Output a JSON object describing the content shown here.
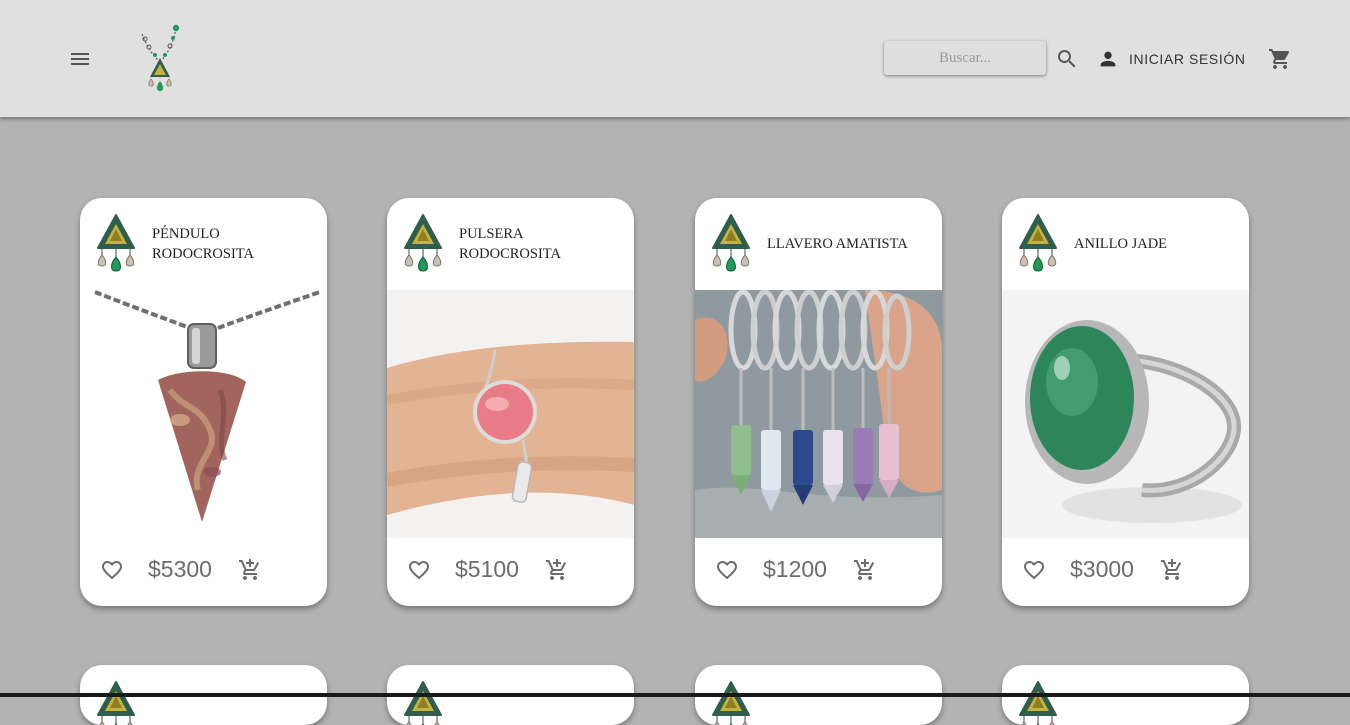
{
  "header": {
    "search": {
      "placeholder": "Buscar..."
    },
    "login_label": "INICIAR SESIÓN"
  },
  "colors": {
    "background": "#b3b3b3",
    "appbar": "#e0e0e0",
    "card": "#ffffff",
    "logo_green": "#1e9b57",
    "logo_gold": "#b8a038"
  },
  "products": [
    {
      "title": "PÉNDULO RODOCROSITA",
      "price": "$5300",
      "image": "pink-stone-pendant-on-chain"
    },
    {
      "title": "PULSERA RODOCROSITA",
      "price": "$5100",
      "image": "pink-stone-bracelet-on-wrist"
    },
    {
      "title": "LLAVERO AMATISTA",
      "price": "$1200",
      "image": "crystal-point-keychains-in-hand"
    },
    {
      "title": "ANILLO JADE",
      "price": "$3000",
      "image": "green-jade-ring"
    }
  ]
}
